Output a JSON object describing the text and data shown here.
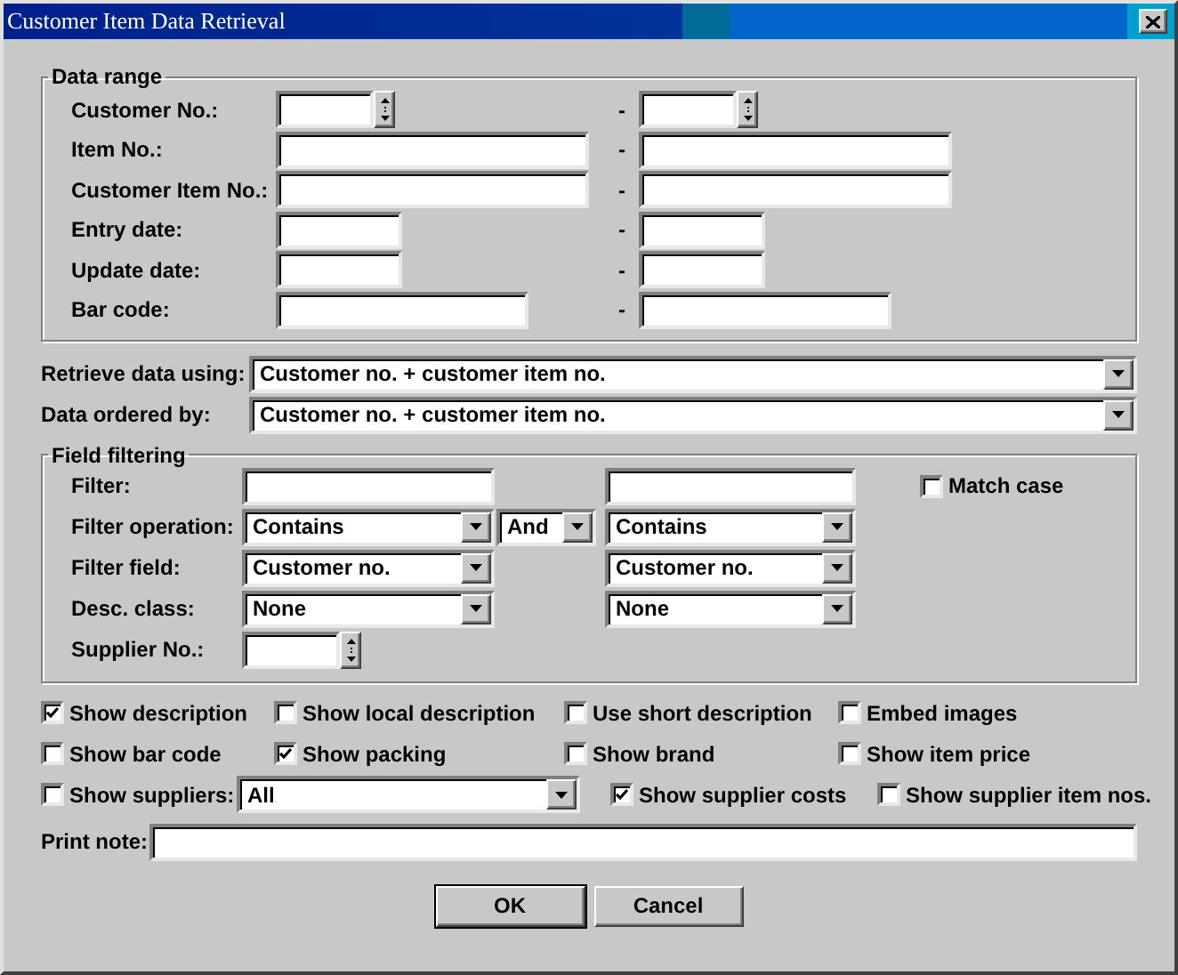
{
  "window": {
    "title": "Customer Item Data Retrieval"
  },
  "data_range": {
    "title": "Data range",
    "rows": [
      {
        "label": "Customer No.:",
        "kind": "spin",
        "separator": "-"
      },
      {
        "label": "Item No.:",
        "kind": "text",
        "separator": "-"
      },
      {
        "label": "Customer Item No.:",
        "kind": "text",
        "separator": "-"
      },
      {
        "label": "Entry date:",
        "kind": "text",
        "separator": "-"
      },
      {
        "label": "Update date:",
        "kind": "text",
        "separator": "-"
      },
      {
        "label": "Bar code:",
        "kind": "text",
        "separator": "-"
      }
    ]
  },
  "retrieve": {
    "label": "Retrieve data using:",
    "value": "Customer no. + customer item no."
  },
  "order": {
    "label": "Data ordered by:",
    "value": "Customer no. + customer item no."
  },
  "field_filtering": {
    "title": "Field filtering",
    "match_case": {
      "label": "Match case",
      "checked": false
    },
    "rows": [
      {
        "label": "Filter:",
        "kind": "text"
      },
      {
        "label": "Filter operation:",
        "kind": "select",
        "left": "Contains",
        "joiner": "And",
        "right": "Contains"
      },
      {
        "label": "Filter field:",
        "kind": "select",
        "left": "Customer no.",
        "right": "Customer no."
      },
      {
        "label": "Desc. class:",
        "kind": "select",
        "left": "None",
        "right": "None"
      },
      {
        "label": "Supplier No.:",
        "kind": "spin"
      }
    ]
  },
  "options": [
    [
      {
        "kind": "checkbox",
        "label": "Show description",
        "checked": true
      },
      {
        "kind": "checkbox",
        "label": "Show local description",
        "checked": false
      },
      {
        "kind": "checkbox",
        "label": "Use short description",
        "checked": false
      },
      {
        "kind": "checkbox",
        "label": "Embed images",
        "checked": false
      }
    ],
    [
      {
        "kind": "checkbox",
        "label": "Show bar code",
        "checked": false
      },
      {
        "kind": "checkbox",
        "label": "Show packing",
        "checked": true
      },
      {
        "kind": "checkbox",
        "label": "Show brand",
        "checked": false
      },
      {
        "kind": "checkbox",
        "label": "Show item price",
        "checked": false
      }
    ],
    [
      {
        "kind": "checkbox",
        "label": "Show suppliers:",
        "checked": false
      },
      {
        "kind": "select",
        "value": "All"
      },
      {
        "kind": "checkbox",
        "label": "Show supplier costs",
        "checked": true
      },
      {
        "kind": "checkbox",
        "label": "Show supplier item nos.",
        "checked": false
      }
    ]
  ],
  "print_note": {
    "label": "Print note:"
  },
  "buttons": [
    {
      "label": "OK",
      "default": true
    },
    {
      "label": "Cancel",
      "default": false
    }
  ]
}
